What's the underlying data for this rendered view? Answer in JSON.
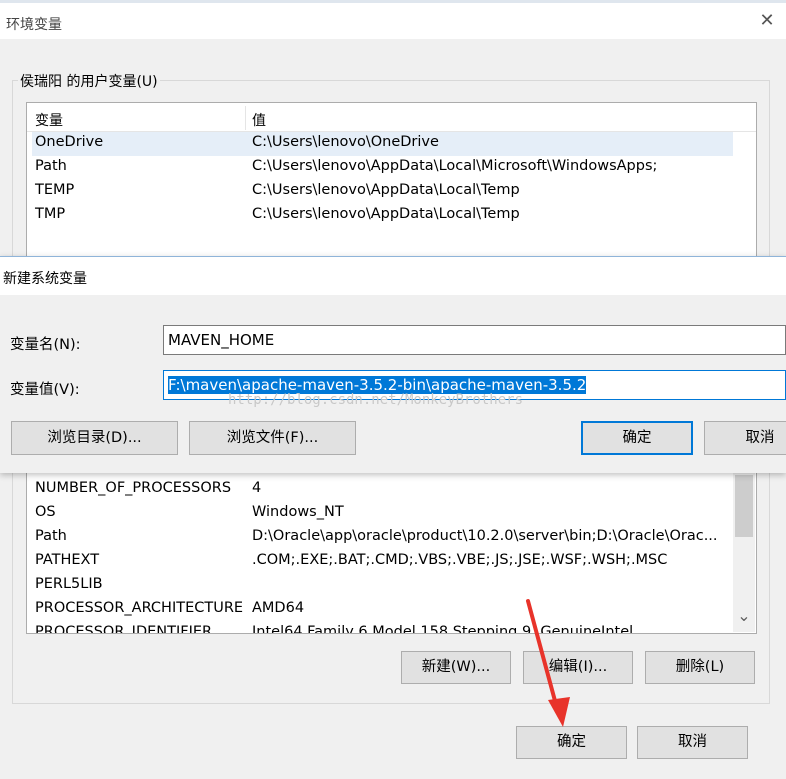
{
  "env_window": {
    "title": "环境变量",
    "close_glyph": "✕",
    "user_group_label": "侯瑞阳 的用户变量(U)",
    "user_columns": [
      "变量",
      "值"
    ],
    "user_rows": [
      {
        "name": "OneDrive",
        "value": "C:\\Users\\lenovo\\OneDrive"
      },
      {
        "name": "Path",
        "value": "C:\\Users\\lenovo\\AppData\\Local\\Microsoft\\WindowsApps;"
      },
      {
        "name": "TEMP",
        "value": "C:\\Users\\lenovo\\AppData\\Local\\Temp"
      },
      {
        "name": "TMP",
        "value": "C:\\Users\\lenovo\\AppData\\Local\\Temp"
      }
    ],
    "system_rows": [
      {
        "name": "NUMBER_OF_PROCESSORS",
        "value": "4"
      },
      {
        "name": "OS",
        "value": "Windows_NT"
      },
      {
        "name": "Path",
        "value": "D:\\Oracle\\app\\oracle\\product\\10.2.0\\server\\bin;D:\\Oracle\\Orac..."
      },
      {
        "name": "PATHEXT",
        "value": ".COM;.EXE;.BAT;.CMD;.VBS;.VBE;.JS;.JSE;.WSF;.WSH;.MSC"
      },
      {
        "name": "PERL5LIB",
        "value": ""
      },
      {
        "name": "PROCESSOR_ARCHITECTURE",
        "value": "AMD64"
      },
      {
        "name": "PROCESSOR_IDENTIFIER",
        "value": "Intel64 Family 6 Model 158 Stepping 9, GenuineIntel"
      }
    ],
    "scroll_down_glyph": "⌄",
    "buttons": {
      "new": "新建(W)...",
      "edit": "编辑(I)...",
      "delete": "删除(L)",
      "ok": "确定",
      "cancel": "取消"
    }
  },
  "new_var_dialog": {
    "title": "新建系统变量",
    "name_label": "变量名(N):",
    "name_value": "MAVEN_HOME",
    "value_label": "变量值(V):",
    "value_value": "F:\\maven\\apache-maven-3.5.2-bin\\apache-maven-3.5.2",
    "buttons": {
      "browse_dir": "浏览目录(D)...",
      "browse_file": "浏览文件(F)...",
      "ok": "确定",
      "cancel": "取消"
    }
  },
  "watermark": "http://blog.csdn.net/MonkeyBrothers",
  "annotation": {
    "arrow_color": "#e8332a"
  }
}
